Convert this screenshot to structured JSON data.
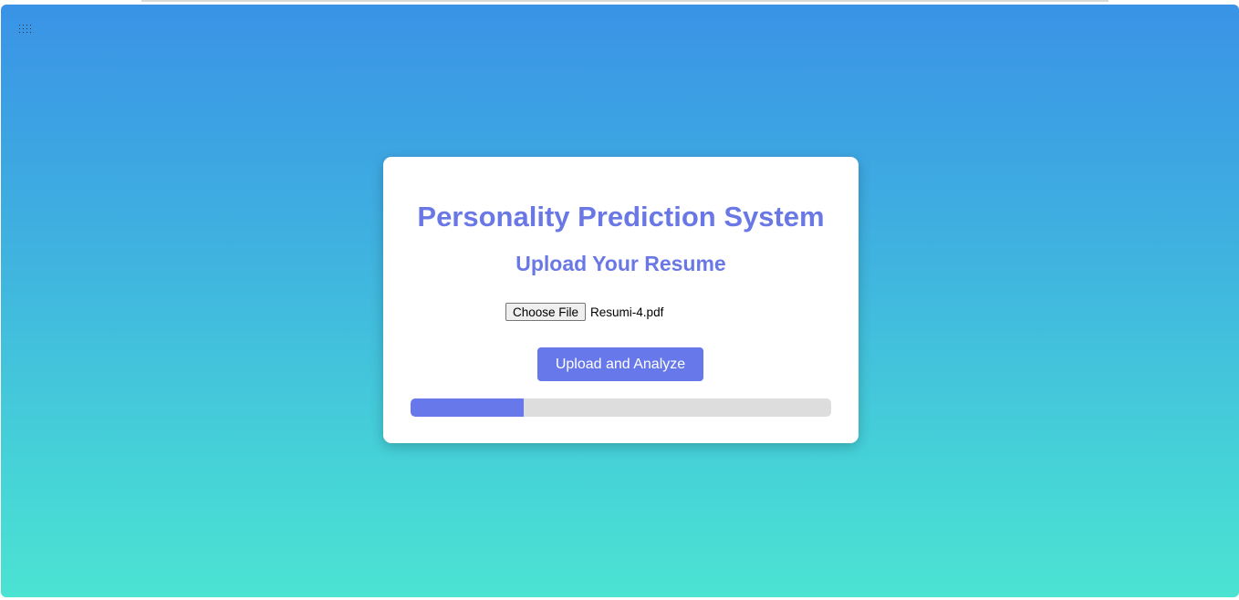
{
  "colors": {
    "accent": "#6778ea",
    "title_text": "#6a78e6",
    "background_top": "#3a93e6",
    "background_bottom": "#4be3d2",
    "progress_track": "#dddddd"
  },
  "header": {
    "menu_icon": "grip-dots-icon"
  },
  "card": {
    "title": "Personality Prediction System",
    "subtitle": "Upload Your Resume",
    "file_input": {
      "button_label": "Choose File",
      "selected_file": "Resumi-4.pdf"
    },
    "submit_label": "Upload and Analyze",
    "progress": {
      "percent": 27
    }
  }
}
